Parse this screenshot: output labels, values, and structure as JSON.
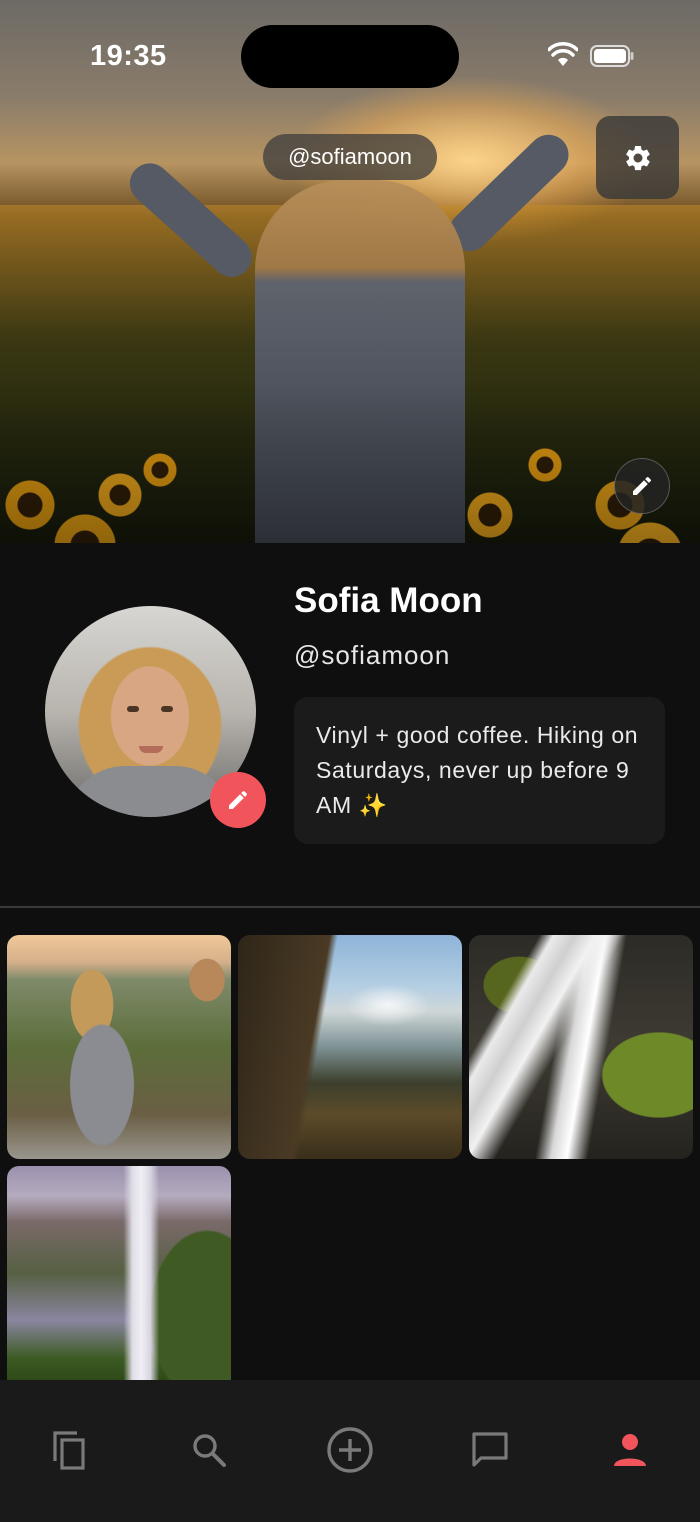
{
  "status_bar": {
    "time": "19:35"
  },
  "header": {
    "handle_pill": "@sofiamoon"
  },
  "profile": {
    "display_name": "Sofia Moon",
    "username": "@sofiamoon",
    "bio": "Vinyl + good coffee. Hiking on Saturdays, never up before 9 AM ✨"
  },
  "grid": {
    "photos": [
      {
        "name": "photo-woman-overlook"
      },
      {
        "name": "photo-waterfall-cliff"
      },
      {
        "name": "photo-waterfall-rocks"
      },
      {
        "name": "photo-waterfall-valley"
      }
    ]
  },
  "tabbar": {
    "items": [
      {
        "name": "feed",
        "icon": "copy-icon",
        "active": false
      },
      {
        "name": "search",
        "icon": "search-icon",
        "active": false
      },
      {
        "name": "create",
        "icon": "plus-circle-icon",
        "active": false
      },
      {
        "name": "messages",
        "icon": "chat-icon",
        "active": false
      },
      {
        "name": "profile",
        "icon": "person-icon",
        "active": true
      }
    ]
  },
  "colors": {
    "accent": "#f2545b",
    "icon_inactive": "#7a7a7a",
    "background": "#0f0f0f",
    "card": "#1b1b1b"
  }
}
